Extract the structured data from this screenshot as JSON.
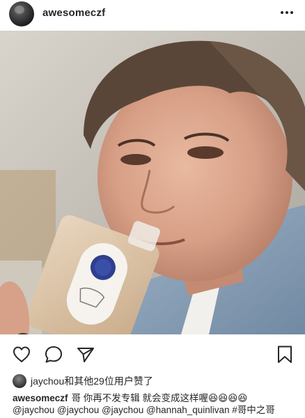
{
  "post": {
    "username": "awesomeczf",
    "more_icon": "more-horizontal-icon",
    "likes_text": "jaychou和其他29位用户赞了",
    "caption_user": "awesomeczf",
    "caption_text": "哥 你再不发专辑 就会变成这样喔😆😆😆😆",
    "caption_mentions": "@jaychou @jaychou @jaychou @hannah_quinlivan #哥中之哥"
  },
  "icons": {
    "like": "heart-icon",
    "comment": "comment-icon",
    "share": "send-icon",
    "save": "bookmark-icon",
    "tag": "person-tag-icon"
  },
  "colors": {
    "text": "#262626",
    "background": "#ffffff"
  }
}
